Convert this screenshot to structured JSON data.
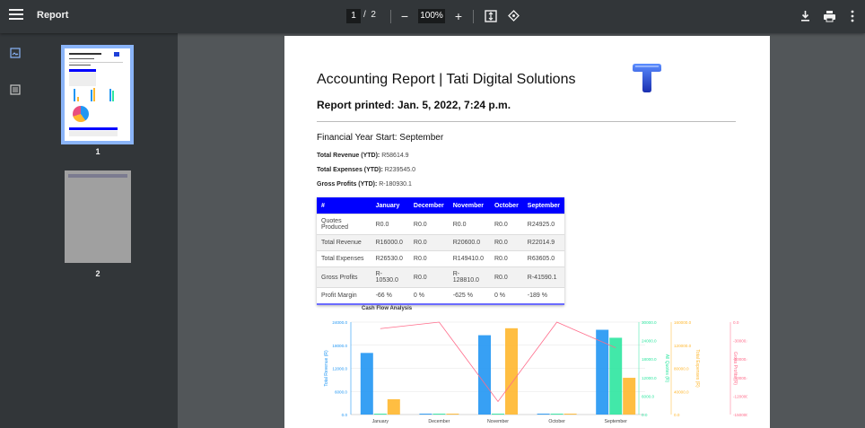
{
  "toolbar": {
    "title": "Report",
    "page_current": "1",
    "page_separator": "/",
    "page_total": "2",
    "zoom": "100%",
    "minus": "−",
    "plus": "+"
  },
  "sidebar": {
    "thumbs": [
      {
        "label": "1"
      },
      {
        "label": "2"
      }
    ]
  },
  "report": {
    "title": "Accounting Report | Tati Digital Solutions",
    "printed": "Report printed: Jan. 5, 2022, 7:24 p.m.",
    "fy_start": "Financial Year Start: September",
    "revenue_label": "Total Revenue (YTD):",
    "revenue_value": "R58614.9",
    "expenses_label": "Total Expenses (YTD):",
    "expenses_value": "R239545.0",
    "profits_label": "Gross Profits (YTD):",
    "profits_value": "R-180930.1",
    "colors": {
      "table_header": "#0000ff",
      "logo": "#1e40d8"
    }
  },
  "table": {
    "headers": [
      "#",
      "January",
      "December",
      "November",
      "October",
      "September"
    ],
    "rows": [
      [
        "Quotes Produced",
        "R0.0",
        "R0.0",
        "R0.0",
        "R0.0",
        "R24925.0"
      ],
      [
        "Total Revenue",
        "R16000.0",
        "R0.0",
        "R20600.0",
        "R0.0",
        "R22014.9"
      ],
      [
        "Total Expenses",
        "R26530.0",
        "R0.0",
        "R149410.0",
        "R0.0",
        "R63605.0"
      ],
      [
        "Gross Profits",
        "R-10530.0",
        "R0.0",
        "R-128810.0",
        "R0.0",
        "R-41590.1"
      ],
      [
        "Profit Margin",
        "-66 %",
        "0 %",
        "-625 %",
        "0 %",
        "-189 %"
      ]
    ]
  },
  "chart_data": {
    "type": "bar",
    "title": "Cash Flow Analysis",
    "categories": [
      "January",
      "December",
      "November",
      "October",
      "September"
    ],
    "series": [
      {
        "name": "Total Revenue (R)",
        "type": "bar",
        "color": "#2196f3",
        "values": [
          16000.0,
          0.0,
          20600.0,
          0.0,
          22014.9
        ],
        "ticks": [
          "24000.0",
          "18000.0",
          "12000.0",
          "6000.0",
          "0.0"
        ],
        "ylim": [
          0,
          24000
        ]
      },
      {
        "name": "All Quotes (R)",
        "type": "bar",
        "color": "#2ee6a0",
        "values": [
          0.0,
          0.0,
          0.0,
          0.0,
          24925.0
        ],
        "ticks": [
          "30000.0",
          "24000.0",
          "18000.0",
          "12000.0",
          "6000.0",
          "0.0"
        ],
        "ylim": [
          0,
          30000
        ]
      },
      {
        "name": "Total Expenses (R)",
        "type": "bar",
        "color": "#ffb72e",
        "values": [
          26530.0,
          0.0,
          149410.0,
          0.0,
          63605.0
        ],
        "ticks": [
          "160000.0",
          "120000.0",
          "80000.0",
          "40000.0",
          "0.0"
        ],
        "ylim": [
          0,
          160000
        ]
      },
      {
        "name": "Gross Profits (R)",
        "type": "line",
        "color": "#ff6b8a",
        "values": [
          -10530.0,
          0.0,
          -128810.0,
          0.0,
          -41590.1
        ],
        "ticks": [
          "0.0",
          "-30000.0",
          "-60000.0",
          "-90000.0",
          "-120000.0",
          "-150000.0"
        ],
        "ylim": [
          -150000,
          0
        ]
      }
    ]
  }
}
